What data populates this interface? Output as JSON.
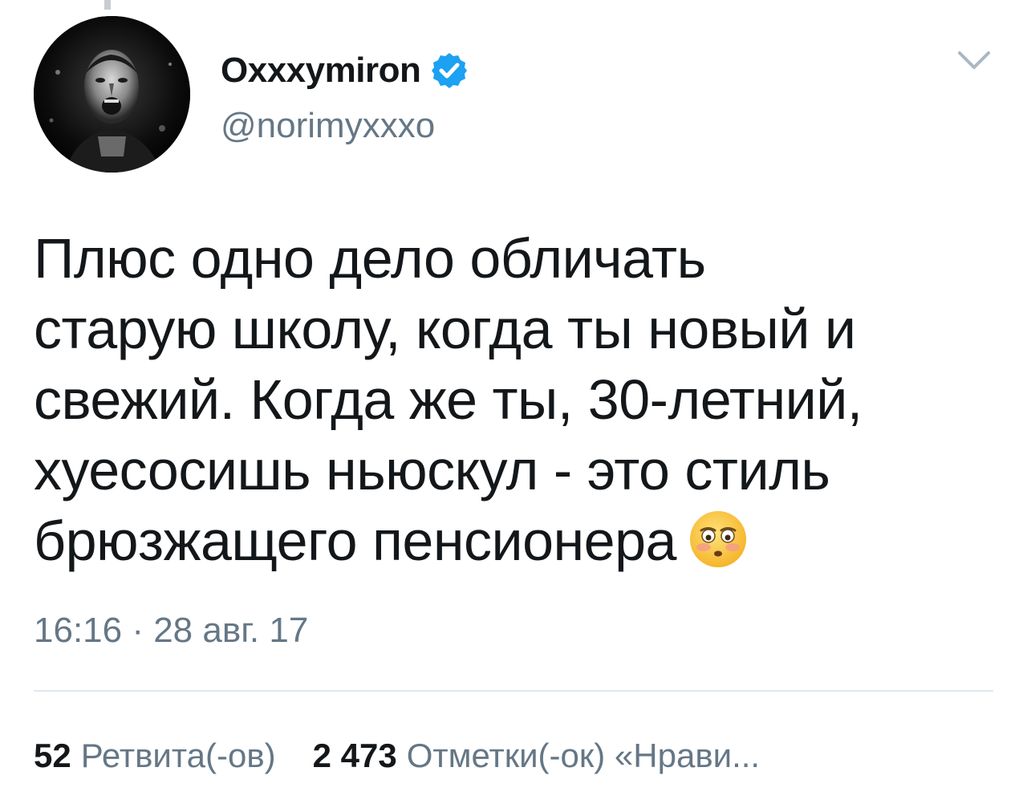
{
  "author": {
    "display_name": "Oxxxymiron",
    "handle": "@norimyxxxo",
    "verified": true,
    "avatar_icon": "avatar-photo"
  },
  "tweet": {
    "lines": [
      "Плюс одно дело обличать",
      "старую школу, когда ты новый и",
      "свежий. Когда же ты, 30-летний,",
      "хуесосишь ньюскул - это стиль",
      "брюзжащего пенсионера"
    ],
    "emoji": "flushed-face-emoji",
    "timestamp": "16:16 · 28 авг. 17"
  },
  "stats": {
    "retweets_count": "52",
    "retweets_label": "Ретвита(-ов)",
    "likes_count": "2 473",
    "likes_label": "Отметки(-ок) «Нрави..."
  },
  "colors": {
    "text_primary": "#14171a",
    "text_secondary": "#657786",
    "verified_blue": "#1da1f2",
    "divider": "#e1e8ed"
  },
  "icons": [
    "verified-badge-icon",
    "chevron-down-icon",
    "flushed-face-emoji"
  ]
}
